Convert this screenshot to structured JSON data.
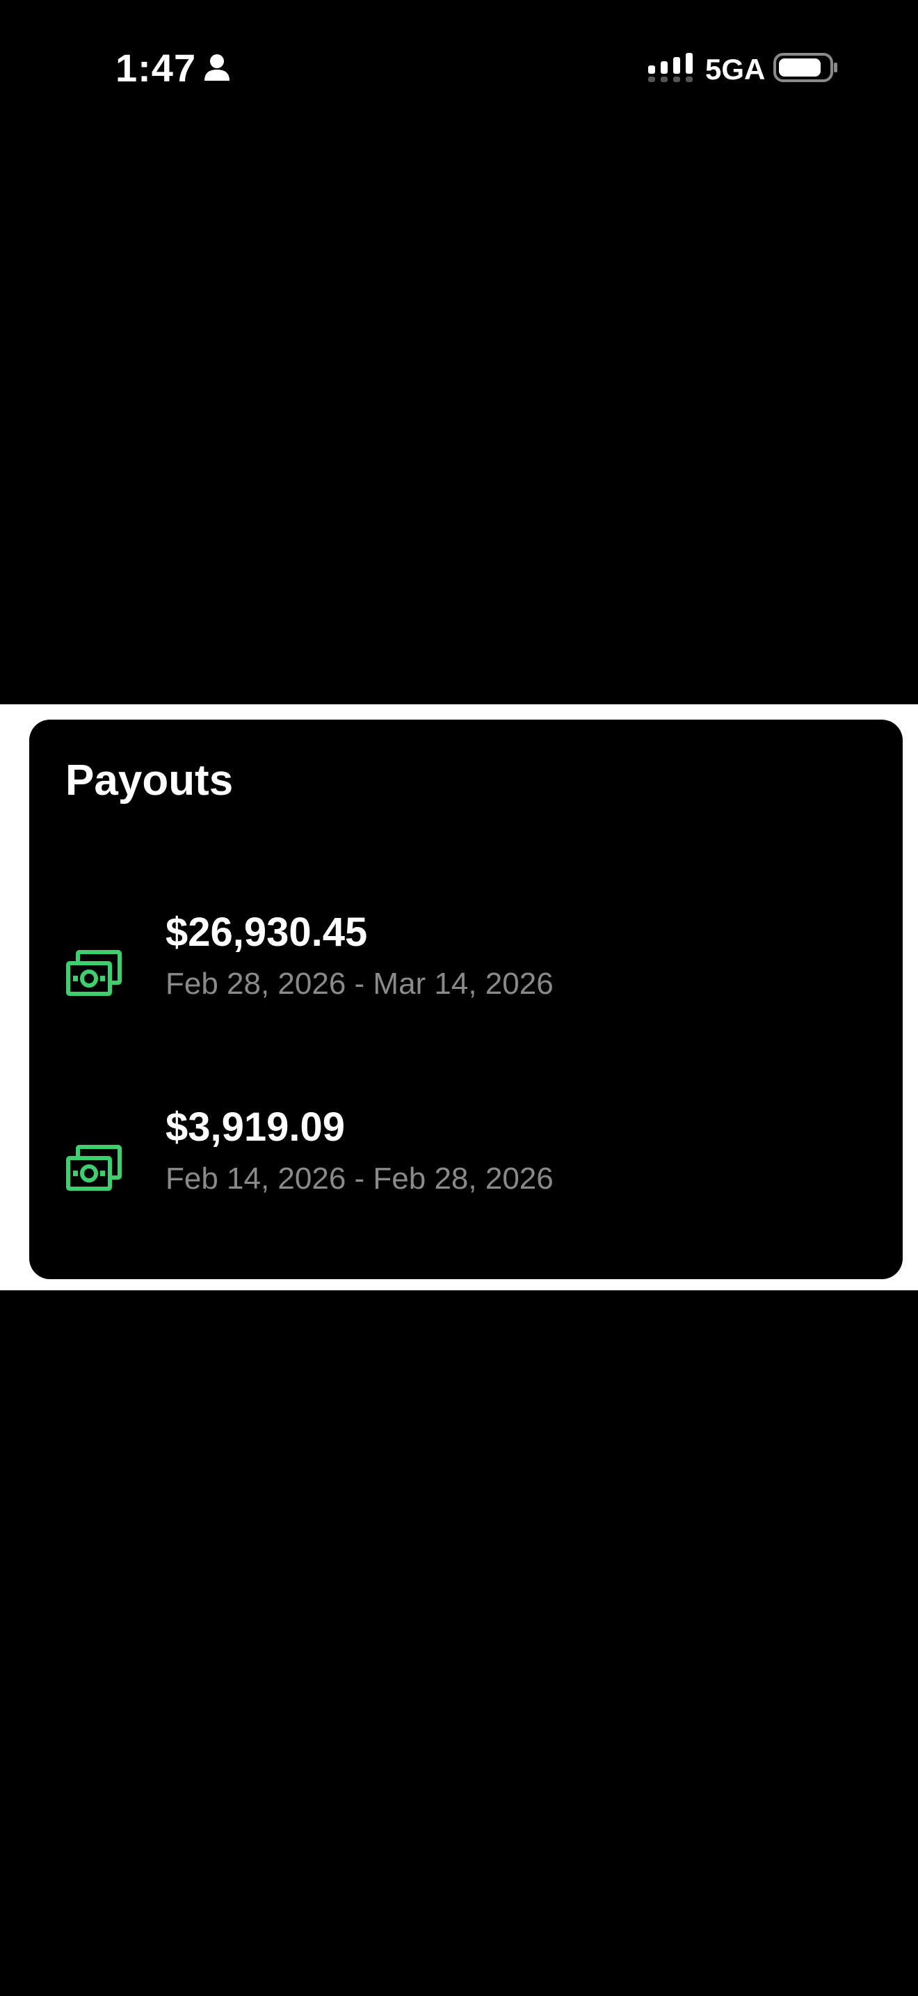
{
  "status_bar": {
    "time": "1:47",
    "network": "5GA",
    "icons": [
      "person-icon",
      "signal-icon",
      "battery-icon"
    ]
  },
  "payouts": {
    "title": "Payouts",
    "items": [
      {
        "amount": "$26,930.45",
        "range": "Feb 28, 2026 - Mar 14, 2026",
        "icon": "money-icon"
      },
      {
        "amount": "$3,919.09",
        "range": "Feb 14, 2026 - Feb 28, 2026",
        "icon": "money-icon"
      }
    ]
  },
  "colors": {
    "background": "#000000",
    "band": "#ffffff",
    "accent_green": "#3ecf6e",
    "secondary_text": "#8a8a8a"
  }
}
